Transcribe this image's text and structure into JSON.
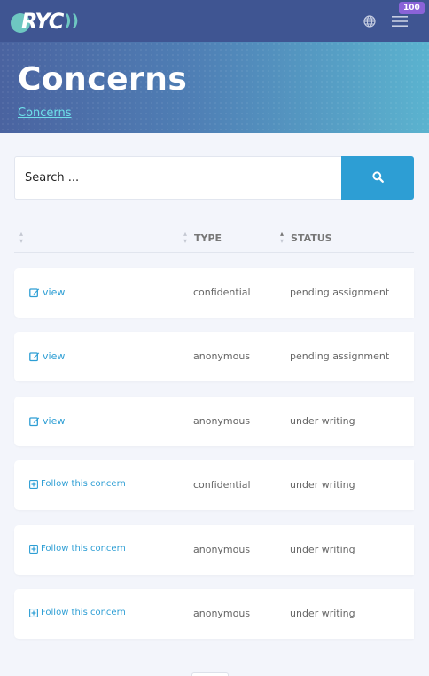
{
  "nav": {
    "logo_text": "RYC",
    "notification_count": "100"
  },
  "hero": {
    "title": "Concerns",
    "breadcrumb": "Concerns"
  },
  "search": {
    "placeholder": "Search ..."
  },
  "table": {
    "columns": [
      "",
      "TYPE",
      "STATUS"
    ],
    "rows": [
      {
        "action": "view",
        "action_kind": "edit",
        "type": "confidential",
        "status": "pending assignment"
      },
      {
        "action": "view",
        "action_kind": "edit",
        "type": "anonymous",
        "status": "pending assignment"
      },
      {
        "action": "view",
        "action_kind": "edit",
        "type": "anonymous",
        "status": "under writing"
      },
      {
        "action": "Follow this concern",
        "action_kind": "follow",
        "type": "confidential",
        "status": "under writing"
      },
      {
        "action": "Follow this concern",
        "action_kind": "follow",
        "type": "anonymous",
        "status": "under writing"
      },
      {
        "action": "Follow this concern",
        "action_kind": "follow",
        "type": "anonymous",
        "status": "under writing"
      }
    ]
  },
  "colors": {
    "navbar": "#3f5592",
    "accent": "#2d9ed4",
    "logo_teal": "#6ec7c1",
    "badge": "#8a63d8"
  },
  "icons": {
    "edit": "edit-icon",
    "follow": "plus-square-icon",
    "search": "search-icon",
    "globe": "globe-icon",
    "menu": "hamburger-menu-icon"
  }
}
